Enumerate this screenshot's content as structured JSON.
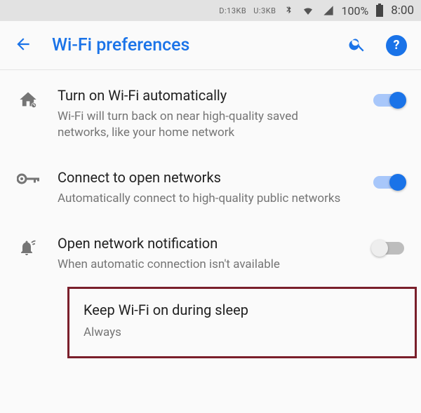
{
  "status": {
    "download": "D:13KB",
    "upload": "U:3KB",
    "battery_pct": "100%",
    "time": "8:00"
  },
  "header": {
    "title": "Wi-Fi preferences"
  },
  "items": [
    {
      "title": "Turn on Wi-Fi automatically",
      "subtitle": "Wi-Fi will turn back on near high-quality saved networks, like your home network",
      "toggle": true
    },
    {
      "title": "Connect to open networks",
      "subtitle": "Automatically connect to high-quality public networks",
      "toggle": true
    },
    {
      "title": "Open network notification",
      "subtitle": "When automatic connection isn't available",
      "toggle": false
    },
    {
      "title": "Keep Wi-Fi on during sleep",
      "subtitle": "Always"
    }
  ]
}
